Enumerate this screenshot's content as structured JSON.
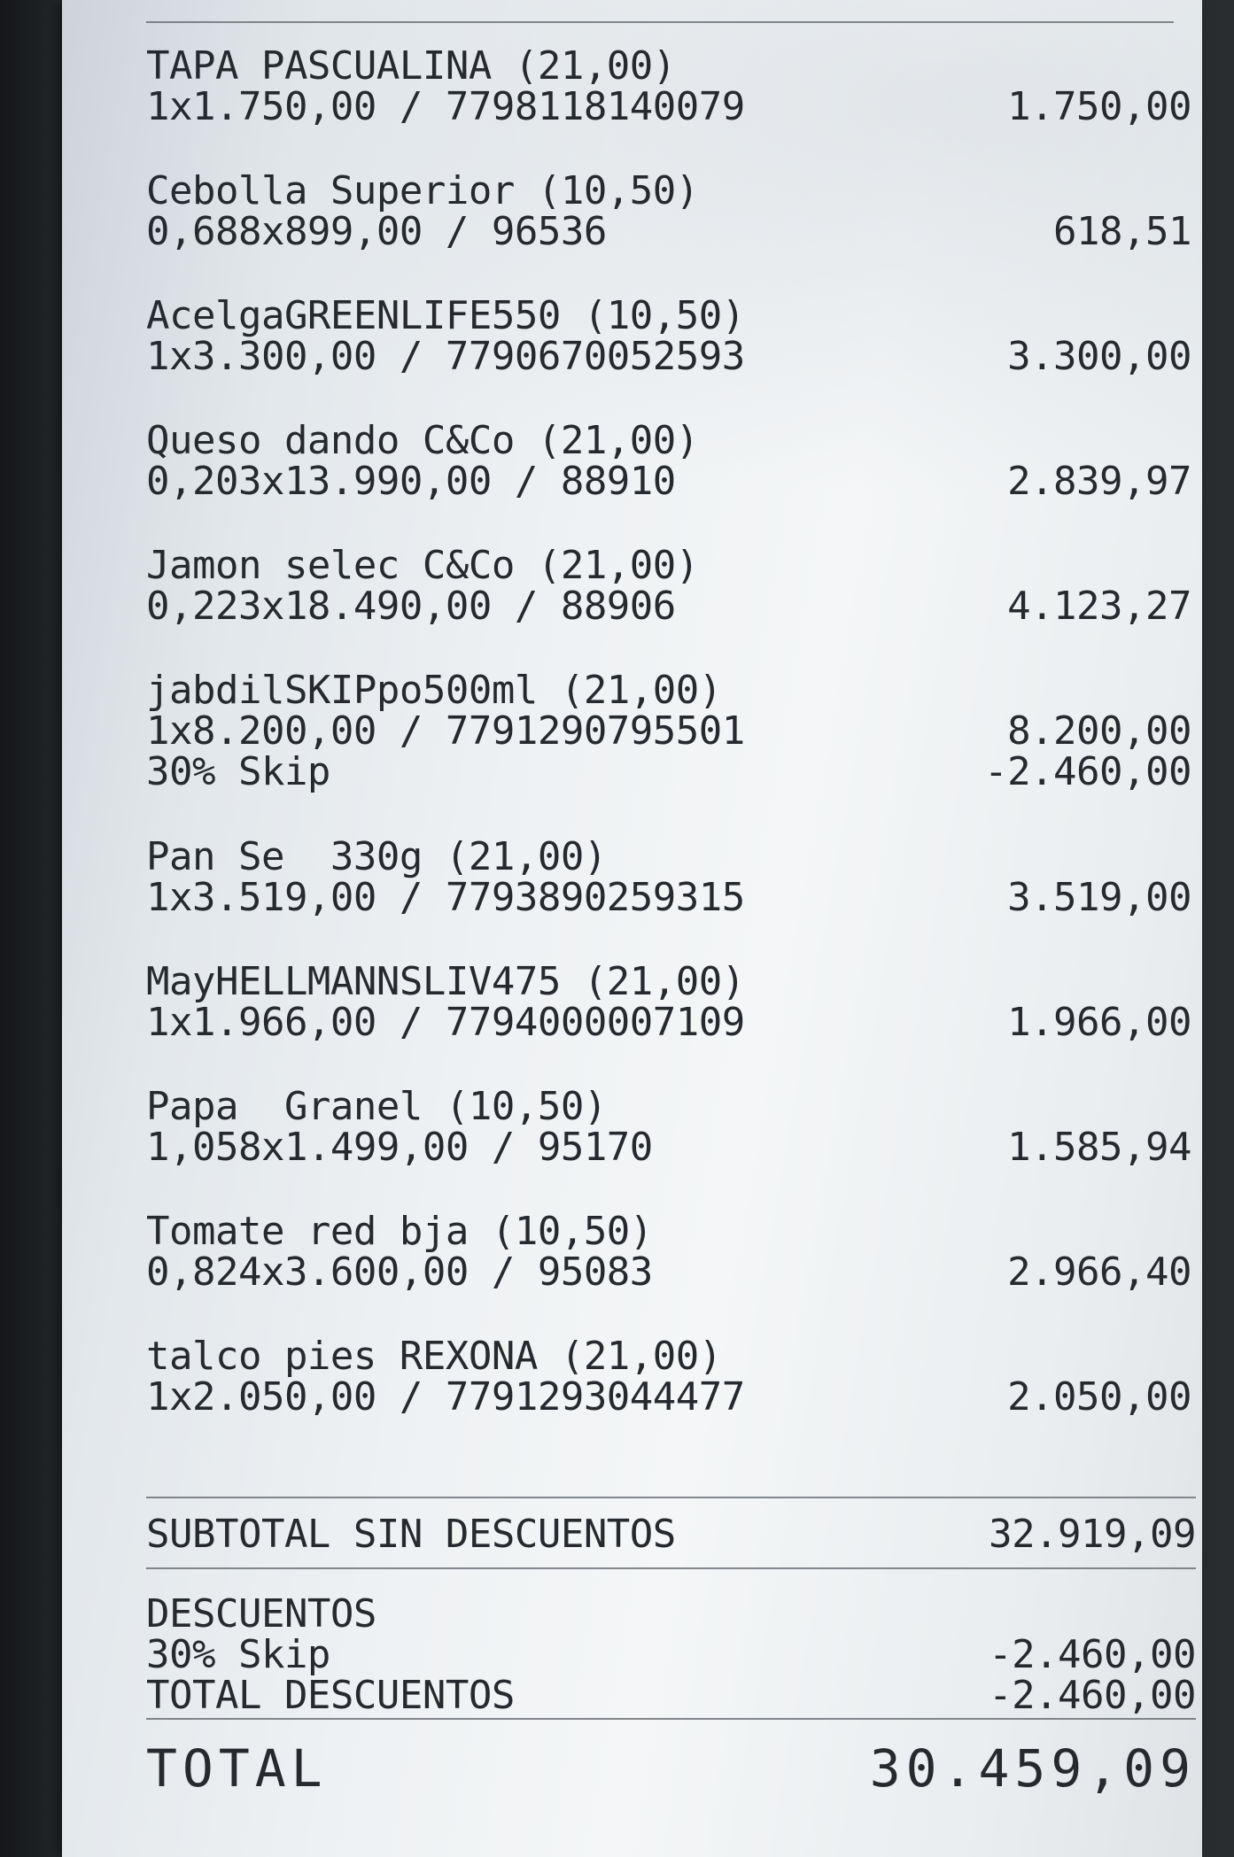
{
  "items": [
    {
      "desc": "TAPA PASCUALINA (21,00)",
      "detail": "1x1.750,00 / 7798118140079",
      "amount": "1.750,00"
    },
    {
      "desc": "Cebolla Superior (10,50)",
      "detail": "0,688x899,00 / 96536",
      "amount": "618,51"
    },
    {
      "desc": "AcelgaGREENLIFE550 (10,50)",
      "detail": "1x3.300,00 / 7790670052593",
      "amount": "3.300,00"
    },
    {
      "desc": "Queso dando C&Co (21,00)",
      "detail": "0,203x13.990,00 / 88910",
      "amount": "2.839,97"
    },
    {
      "desc": "Jamon selec C&Co (21,00)",
      "detail": "0,223x18.490,00 / 88906",
      "amount": "4.123,27"
    },
    {
      "desc": "jabdilSKIPpo500ml (21,00)",
      "detail": "1x8.200,00 / 7791290795501",
      "amount": "8.200,00",
      "discount_label": "30% Skip",
      "discount_amount": "-2.460,00"
    },
    {
      "desc": "Pan Se  330g (21,00)",
      "detail": "1x3.519,00 / 7793890259315",
      "amount": "3.519,00"
    },
    {
      "desc": "MayHELLMANNSLIV475 (21,00)",
      "detail": "1x1.966,00 / 7794000007109",
      "amount": "1.966,00"
    },
    {
      "desc": "Papa  Granel (10,50)",
      "detail": "1,058x1.499,00 / 95170",
      "amount": "1.585,94"
    },
    {
      "desc": "Tomate red bja (10,50)",
      "detail": "0,824x3.600,00 / 95083",
      "amount": "2.966,40"
    },
    {
      "desc": "talco pies REXONA (21,00)",
      "detail": "1x2.050,00 / 7791293044477",
      "amount": "2.050,00"
    }
  ],
  "subtotal": {
    "label": "SUBTOTAL SIN DESCUENTOS",
    "amount": "32.919,09"
  },
  "discounts": {
    "heading": "DESCUENTOS",
    "line_label": "30% Skip",
    "line_amount": "-2.460,00",
    "total_label": "TOTAL DESCUENTOS",
    "total_amount": "-2.460,00"
  },
  "total": {
    "label": "TOTAL",
    "amount": "30.459,09"
  }
}
